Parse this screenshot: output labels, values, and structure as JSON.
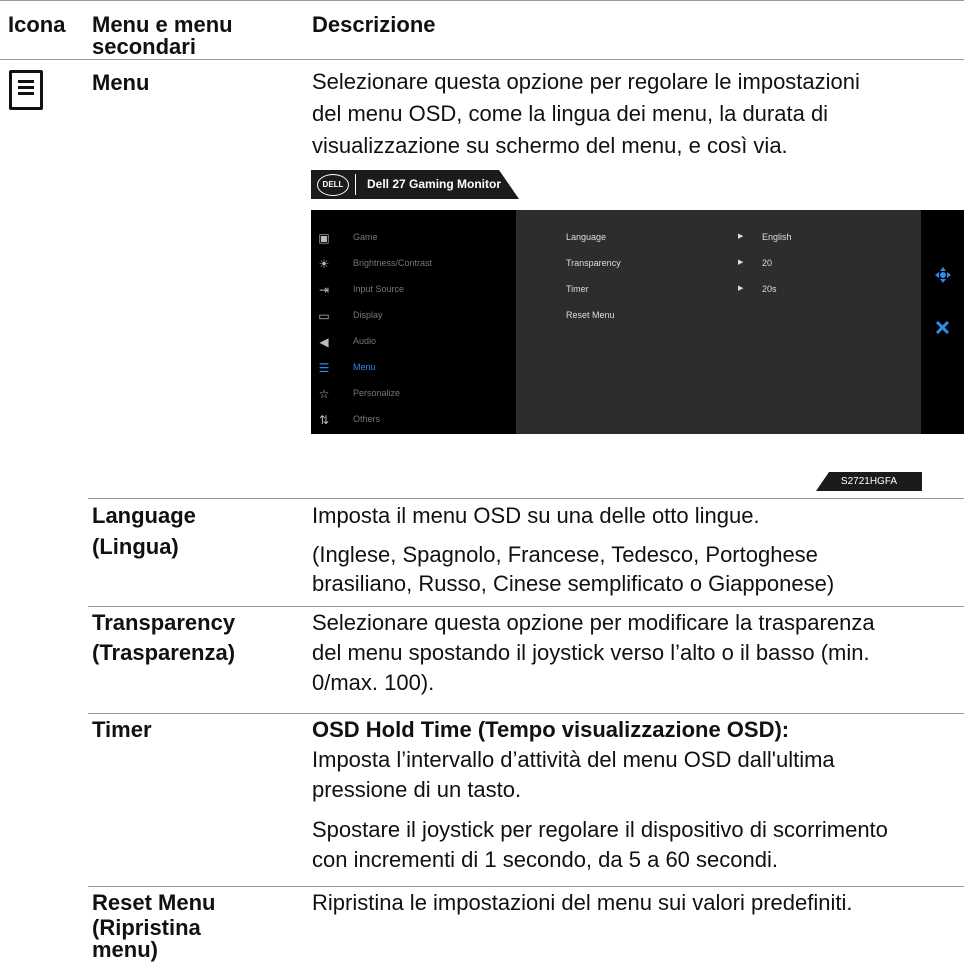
{
  "headers": {
    "icon": "Icona",
    "menu_line1": "Menu e menu",
    "menu_line2": "secondari",
    "description": "Descrizione"
  },
  "menu_row": {
    "icon": "menu-list-icon",
    "name": "Menu",
    "desc_lines": [
      "Selezionare questa opzione per regolare le impostazioni",
      "del menu OSD, come la lingua dei menu, la durata di",
      "visualizzazione su schermo del menu, e così via."
    ]
  },
  "osd": {
    "brand": "DELL",
    "title": "Dell 27 Gaming Monitor",
    "model": "S2721HGFA",
    "accent": "#2e8be6",
    "menu_items": [
      {
        "icon": "game-icon",
        "glyph": "▣",
        "label": "Game"
      },
      {
        "icon": "brightness-icon",
        "glyph": "☀",
        "label": "Brightness/Contrast"
      },
      {
        "icon": "input-source-icon",
        "glyph": "⇥",
        "label": "Input Source"
      },
      {
        "icon": "display-icon",
        "glyph": "▭",
        "label": "Display"
      },
      {
        "icon": "audio-icon",
        "glyph": "◀",
        "label": "Audio"
      },
      {
        "icon": "menu-icon",
        "glyph": "☰",
        "label": "Menu",
        "active": true
      },
      {
        "icon": "star-icon",
        "glyph": "☆",
        "label": "Personalize"
      },
      {
        "icon": "others-icon",
        "glyph": "⇅",
        "label": "Others"
      }
    ],
    "settings": [
      {
        "label": "Language",
        "value": "English"
      },
      {
        "label": "Transparency",
        "value": "20"
      },
      {
        "label": "Timer",
        "value": "20s"
      },
      {
        "label": "Reset Menu",
        "value": ""
      }
    ],
    "side_icons": [
      "joystick-icon",
      "close-icon"
    ]
  },
  "rows": {
    "language": {
      "name_lines": [
        "Language",
        "(Lingua)"
      ],
      "desc1": "Imposta il menu OSD su una delle otto lingue.",
      "desc2_lines": [
        "(Inglese, Spagnolo, Francese, Tedesco, Portoghese",
        "brasiliano, Russo, Cinese semplificato o Giapponese)"
      ]
    },
    "transparency": {
      "name_lines": [
        "Transparency",
        "(Trasparenza)"
      ],
      "desc_lines": [
        "Selezionare questa opzione per modificare la trasparenza",
        "del menu spostando il joystick verso l’alto o il basso (min.",
        "0/max. 100)."
      ]
    },
    "timer": {
      "name": "Timer",
      "heading": "OSD Hold Time (Tempo visualizzazione OSD):",
      "desc1_lines": [
        "Imposta l’intervallo d’attività del menu OSD dall'ultima",
        "pressione di un tasto."
      ],
      "desc2_lines": [
        "Spostare il joystick per regolare il dispositivo di scorrimento",
        "con incrementi di 1 secondo, da 5 a 60 secondi."
      ]
    },
    "reset": {
      "name_lines": [
        "Reset Menu",
        "(Ripristina",
        "menu)"
      ],
      "desc": "Ripristina le impostazioni del menu sui valori predefiniti."
    }
  }
}
